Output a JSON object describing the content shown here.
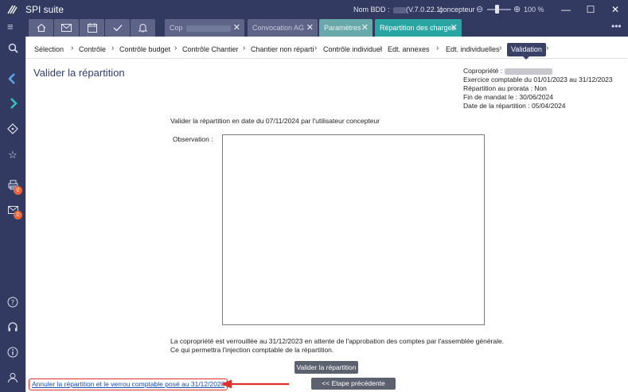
{
  "app": {
    "title": "SPI suite"
  },
  "titlebar": {
    "bdd_label": "Nom BDD :",
    "version": "(V.7.0.22.1)",
    "user": "concepteur",
    "zoom_out": "⊖",
    "zoom_in": "⊕",
    "zoom_level": "100 %",
    "minimize": "—",
    "maximize": "☐",
    "close": "✕"
  },
  "tabs": {
    "icon_tabs": [
      "home-icon",
      "mail-icon",
      "calendar-icon",
      "check-icon",
      "bell-icon"
    ],
    "doc_tabs": [
      {
        "label": "Cop"
      },
      {
        "label": "Convocation AG"
      },
      {
        "label": "Paramètres"
      },
      {
        "label": "Répartition des charges"
      }
    ],
    "more": "•••"
  },
  "sidebar": {
    "icons": [
      "menu-icon",
      "search-icon",
      "arrow-left-icon",
      "arrow-right-icon",
      "diamond-icon",
      "star-icon",
      "print-icon",
      "mail-icon",
      "help-icon",
      "headset-icon",
      "info-icon",
      "user-icon"
    ],
    "badges": [
      "0",
      "0"
    ]
  },
  "breadcrumb": {
    "items": [
      "Sélection",
      "Contrôle",
      "Contrôle budget",
      "Contrôle Chantier",
      "Chantier non réparti",
      "Contrôle individuel",
      "Edt. annexes",
      "Edt. individuelles",
      "Validation"
    ],
    "active": "Validation"
  },
  "page": {
    "title": "Valider la répartition",
    "info": {
      "copropriete": "Copropriété :",
      "exercice": "Exercice comptable du 01/01/2023 au 31/12/2023",
      "prorata": "Répartition au prorata : Non",
      "fin_mandat": "Fin de mandat le : 30/06/2024",
      "date_repartition": "Date de la répartition : 05/04/2024"
    },
    "validate_text": "Valider la répartition en date du 07/11/2024 par l'utilisateur concepteur",
    "observation_label": "Observation :",
    "observation_value": "",
    "lock_line1": "La copropriété est verrouillée au 31/12/2023 en attente de l'approbation des comptes par l'assemblée générale.",
    "lock_line2": "Ce qui permettra l'injection comptable de la répartition.",
    "validate_button": "Valider la répartition",
    "prev_button": "<< Etape précédente",
    "cancel_link": "Annuler la répartition et le verrou comptable posé au 31/12/2023"
  },
  "colors": {
    "frame": "#323a62",
    "tab_active": "#2aa5a3",
    "button": "#5c6170",
    "highlight": "#e0302c",
    "link": "#1a4eb3"
  }
}
